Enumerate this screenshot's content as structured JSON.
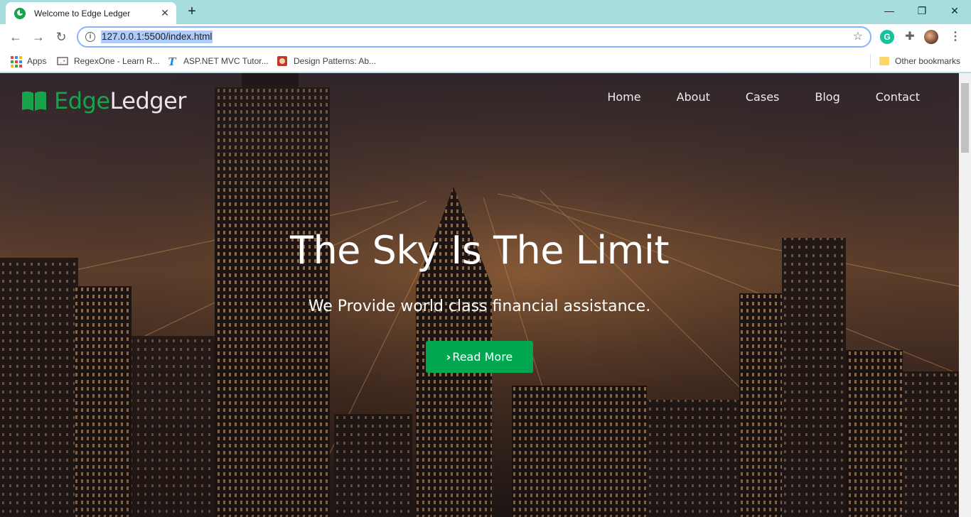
{
  "browser": {
    "tab_title": "Welcome to Edge Ledger",
    "tab_close": "✕",
    "new_tab": "+",
    "url": "127.0.0.1:5500/index.html",
    "window_controls": {
      "minimize": "—",
      "restore": "❐",
      "close": "✕"
    },
    "nav": {
      "back": "←",
      "forward": "→",
      "reload": "↻"
    },
    "bookmarks": [
      {
        "label": "Apps",
        "icon": "apps-grid-icon"
      },
      {
        "label": "RegexOne - Learn R...",
        "icon": "regexone-icon"
      },
      {
        "label": "ASP.NET MVC Tutor...",
        "icon": "tutorialsteacher-icon"
      },
      {
        "label": "Design Patterns: Ab...",
        "icon": "refactoring-guru-icon"
      }
    ],
    "other_bookmarks": "Other bookmarks",
    "extensions": {
      "grammarly": "G"
    }
  },
  "site": {
    "logo": {
      "part1": "Edge",
      "part2": "Ledger"
    },
    "nav_links": [
      "Home",
      "About",
      "Cases",
      "Blog",
      "Contact"
    ],
    "hero": {
      "title": "The Sky Is The Limit",
      "subtitle": "We Provide world class financial assistance.",
      "button_icon": "›",
      "button_label": "Read More"
    }
  },
  "colors": {
    "brand_green": "#16a34a",
    "button_green": "#00a650",
    "tab_strip": "#a7dedd"
  }
}
